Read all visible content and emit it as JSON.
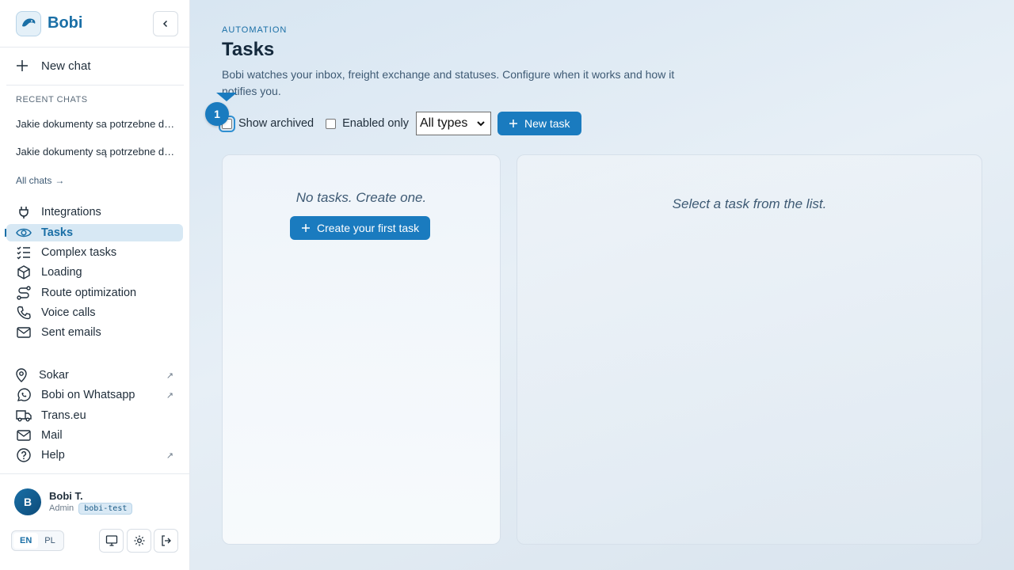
{
  "brand": {
    "name": "Bobi"
  },
  "sidebar": {
    "new_chat": "New chat",
    "recent_title": "RECENT CHATS",
    "recent": [
      "Jakie dokumenty sa potrzebne do przewozu",
      "Jakie dokumenty są potrzebne do przewozu"
    ],
    "all_chats": "All chats",
    "nav": [
      {
        "label": "Integrations",
        "icon": "plug-icon"
      },
      {
        "label": "Tasks",
        "icon": "eye-icon",
        "active": true
      },
      {
        "label": "Complex tasks",
        "icon": "checklist-icon"
      },
      {
        "label": "Loading",
        "icon": "box-icon"
      },
      {
        "label": "Route optimization",
        "icon": "route-icon"
      },
      {
        "label": "Voice calls",
        "icon": "phone-icon"
      },
      {
        "label": "Sent emails",
        "icon": "mail-icon"
      }
    ],
    "links": [
      {
        "label": "Sokar",
        "icon": "location-icon",
        "external": true
      },
      {
        "label": "Bobi on Whatsapp",
        "icon": "whatsapp-icon",
        "external": true
      },
      {
        "label": "Trans.eu",
        "icon": "truck-icon",
        "external": false
      },
      {
        "label": "Mail",
        "icon": "mail-icon",
        "external": false
      },
      {
        "label": "Help",
        "icon": "help-icon",
        "external": true
      }
    ],
    "external_glyph": "↗"
  },
  "user": {
    "initial": "B",
    "name": "Bobi T.",
    "role": "Admin",
    "badge": "bobi-test"
  },
  "lang": {
    "en": "EN",
    "pl": "PL",
    "selected": "EN"
  },
  "main": {
    "eyebrow": "AUTOMATION",
    "title": "Tasks",
    "subtitle": "Bobi watches your inbox, freight exchange and statuses. Configure when it works and how it notifies you.",
    "filters": {
      "show_archived": "Show archived",
      "show_archived_checked": false,
      "enabled_only": "Enabled only",
      "enabled_only_checked": false,
      "type_selected": "All types",
      "new_task": "New task"
    },
    "marker": "1",
    "list_empty": "No tasks. Create one.",
    "create_first": "Create your first task",
    "detail_empty": "Select a task from the list."
  },
  "colors": {
    "accent": "#1a7bbf",
    "brand": "#1a6fa6",
    "active_bg": "#d7e8f4"
  }
}
